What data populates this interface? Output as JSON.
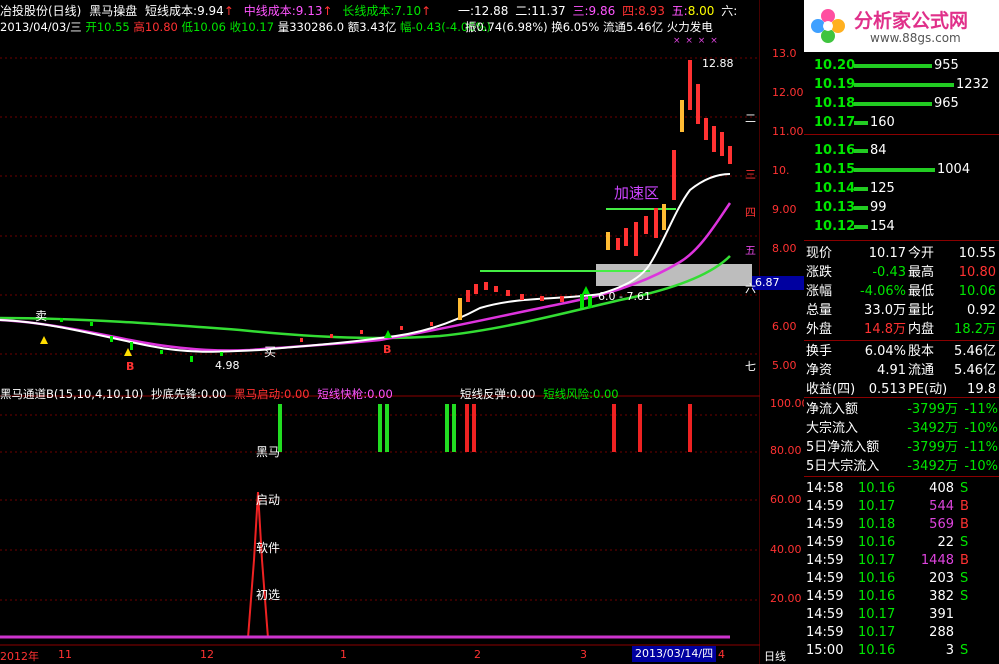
{
  "header": {
    "stock_name": "冶投股份(日线)",
    "indicator_name": "黑马操盘",
    "short_cost_label": "短线成本:",
    "short_cost_value": "9.94",
    "mid_cost_label": "中线成本:",
    "mid_cost_value": "9.13",
    "long_cost_label": "长线成本:",
    "long_cost_value": "7.10",
    "level1_label": "一:",
    "level1_value": "12.88",
    "level2_label": "二:",
    "level2_value": "11.37",
    "level3_label": "三:",
    "level3_value": "9.86",
    "level4_label": "四:",
    "level4_value": "8.93",
    "level5_label": "五:",
    "level5_value": "8.00",
    "level6_label": "六:"
  },
  "info_line": {
    "date": "2013/04/03/三",
    "open_label": "开",
    "open_value": "10.55",
    "high_label": "高",
    "high_value": "10.80",
    "low_label": "低",
    "low_value": "10.06",
    "close_label": "收",
    "close_value": "10.17",
    "volume_label": "量",
    "volume_value": "330286.0",
    "amount_label": "额",
    "amount_value": "3.43亿",
    "change_label": "幅",
    "change_value": "-0.43(-4.06%)",
    "amplitude_label": "振",
    "amplitude_value": "0.74(6.98%)",
    "turnover_label": "换",
    "turnover_value": "6.05%",
    "float_label": "流通",
    "float_value": "5.46亿",
    "fire_label": "火力发电"
  },
  "main_chart": {
    "price_axis": [
      "13.0",
      "12.00",
      "11.00",
      "10.",
      "9.00",
      "8.00",
      "7.00",
      "6.00",
      "5.00"
    ],
    "price_axis_highlight": "6.87",
    "max_label": "12.88",
    "min_label": "4.98",
    "zone_label": "加速区",
    "range_label": "6.0 - 7.61",
    "buy_label": "买",
    "sell_label": "卖",
    "b_label": "B",
    "right_side_marks": [
      "二",
      "三",
      "四",
      "五",
      "六",
      "七"
    ],
    "x_marks": "× × × ×"
  },
  "sub_chart": {
    "title": "黑马通道B(15,10,4,10,10)",
    "bottom_fish_label": "抄底先锋:",
    "bottom_fish_value": "0.00",
    "dark_horse_start_label": "黑马启动:",
    "dark_horse_start_value": "0.00",
    "short_quick_label": "短线快枪:",
    "short_quick_value": "0.00",
    "short_rebound_label": "短线反弹:",
    "short_rebound_value": "0.00",
    "short_risk_label": "短线风险:",
    "short_risk_value": "0.00",
    "axis": [
      "100.00",
      "80.00",
      "60.00",
      "40.00",
      "20.00"
    ],
    "labels": [
      "黑马",
      "启动",
      "软件",
      "初选"
    ]
  },
  "x_axis": {
    "labels": [
      "2012年",
      "11",
      "12",
      "1",
      "2",
      "3",
      "4"
    ],
    "cursor_date": "2013/03/14/四",
    "period": "日线"
  },
  "logo": {
    "title": "分析家公式网",
    "url": "www.88gs.com"
  },
  "order_book": {
    "asks": [
      {
        "price": "10.20",
        "volume": "955"
      },
      {
        "price": "10.19",
        "volume": "1232"
      },
      {
        "price": "10.18",
        "volume": "965"
      },
      {
        "price": "10.17",
        "volume": "160"
      }
    ],
    "bids": [
      {
        "price": "10.16",
        "volume": "84"
      },
      {
        "price": "10.15",
        "volume": "1004"
      },
      {
        "price": "10.14",
        "volume": "125"
      },
      {
        "price": "10.13",
        "volume": "99"
      },
      {
        "price": "10.12",
        "volume": "154"
      }
    ]
  },
  "quote": {
    "rows": [
      {
        "l1": "现价",
        "v1": "10.17",
        "l2": "今开",
        "v2": "10.55"
      },
      {
        "l1": "涨跌",
        "v1": "-0.43",
        "l2": "最高",
        "v2": "10.80"
      },
      {
        "l1": "涨幅",
        "v1": "-4.06%",
        "l2": "最低",
        "v2": "10.06"
      },
      {
        "l1": "总量",
        "v1": "33.0万",
        "l2": "量比",
        "v2": "0.92"
      },
      {
        "l1": "外盘",
        "v1": "14.8万",
        "l2": "内盘",
        "v2": "18.2万"
      }
    ],
    "rows2": [
      {
        "l1": "换手",
        "v1": "6.04%",
        "l2": "股本",
        "v2": "5.46亿"
      },
      {
        "l1": "净资",
        "v1": "4.91",
        "l2": "流通",
        "v2": "5.46亿"
      },
      {
        "l1": "收益(四)",
        "v1": "0.513",
        "l2": "PE(动)",
        "v2": "19.8"
      }
    ],
    "flows": [
      {
        "label": "净流入额",
        "value": "-3799万",
        "pct": "-11%"
      },
      {
        "label": "大宗流入",
        "value": "-3492万",
        "pct": "-10%"
      },
      {
        "label": "5日净流入额",
        "value": "-3799万",
        "pct": "-11%"
      },
      {
        "label": "5日大宗流入",
        "value": "-3492万",
        "pct": "-10%"
      }
    ]
  },
  "ticks": [
    {
      "time": "14:58",
      "price": "10.16",
      "vol": "408",
      "side": "S"
    },
    {
      "time": "14:59",
      "price": "10.17",
      "vol": "544",
      "side": "B"
    },
    {
      "time": "14:59",
      "price": "10.18",
      "vol": "569",
      "side": "B"
    },
    {
      "time": "14:59",
      "price": "10.16",
      "vol": "22",
      "side": "S"
    },
    {
      "time": "14:59",
      "price": "10.17",
      "vol": "1448",
      "side": "B"
    },
    {
      "time": "14:59",
      "price": "10.16",
      "vol": "203",
      "side": "S"
    },
    {
      "time": "14:59",
      "price": "10.16",
      "vol": "382",
      "side": "S"
    },
    {
      "time": "14:59",
      "price": "10.17",
      "vol": "391",
      "side": ""
    },
    {
      "time": "14:59",
      "price": "10.17",
      "vol": "288",
      "side": ""
    },
    {
      "time": "15:00",
      "price": "10.16",
      "vol": "3",
      "side": "S"
    }
  ],
  "colors": {
    "up": "#ff3232",
    "down": "#00e600",
    "accent": "#ff55ff",
    "label_yellow": "#ffff00"
  }
}
